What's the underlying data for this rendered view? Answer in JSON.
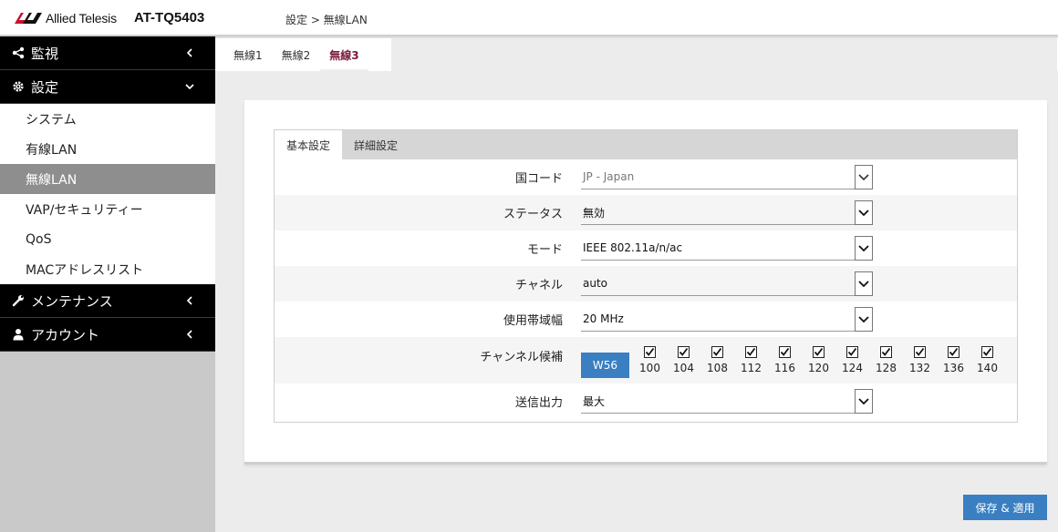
{
  "header": {
    "brand": "Allied Telesis",
    "model": "AT-TQ5403",
    "breadcrumb": "設定 > 無線LAN"
  },
  "sidebar": {
    "groups": [
      {
        "label": "監視",
        "icon": "share-icon",
        "expanded": false
      },
      {
        "label": "設定",
        "icon": "gear-icon",
        "expanded": true
      },
      {
        "label": "メンテナンス",
        "icon": "wrench-icon",
        "expanded": false
      },
      {
        "label": "アカウント",
        "icon": "user-icon",
        "expanded": false
      }
    ],
    "settings_items": [
      {
        "label": "システム",
        "active": false
      },
      {
        "label": "有線LAN",
        "active": false
      },
      {
        "label": "無線LAN",
        "active": true
      },
      {
        "label": "VAP/セキュリティー",
        "active": false
      },
      {
        "label": "QoS",
        "active": false
      },
      {
        "label": "MACアドレスリスト",
        "active": false
      }
    ]
  },
  "radio_tabs": [
    {
      "label": "無線1",
      "active": false
    },
    {
      "label": "無線2",
      "active": false
    },
    {
      "label": "無線3",
      "active": true
    }
  ],
  "inner_tabs": [
    {
      "label": "基本設定",
      "active": true
    },
    {
      "label": "詳細設定",
      "active": false
    }
  ],
  "form": {
    "country": {
      "label": "国コード",
      "value": "JP - Japan"
    },
    "status": {
      "label": "ステータス",
      "value": "無効"
    },
    "mode": {
      "label": "モード",
      "value": "IEEE 802.11a/n/ac"
    },
    "channel": {
      "label": "チャネル",
      "value": "auto"
    },
    "bandwidth": {
      "label": "使用帯域幅",
      "value": "20 MHz"
    },
    "channel_candidates": {
      "label": "チャンネル候補",
      "group_button": "W56",
      "channels": [
        "100",
        "104",
        "108",
        "112",
        "116",
        "120",
        "124",
        "128",
        "132",
        "136",
        "140"
      ]
    },
    "tx_power": {
      "label": "送信出力",
      "value": "最大"
    }
  },
  "actions": {
    "save_apply": "保存 & 適用"
  },
  "colors": {
    "accent": "#3a7fc1",
    "active_tab_text": "#7a1a3a",
    "sidebar_dark": "#000000"
  }
}
